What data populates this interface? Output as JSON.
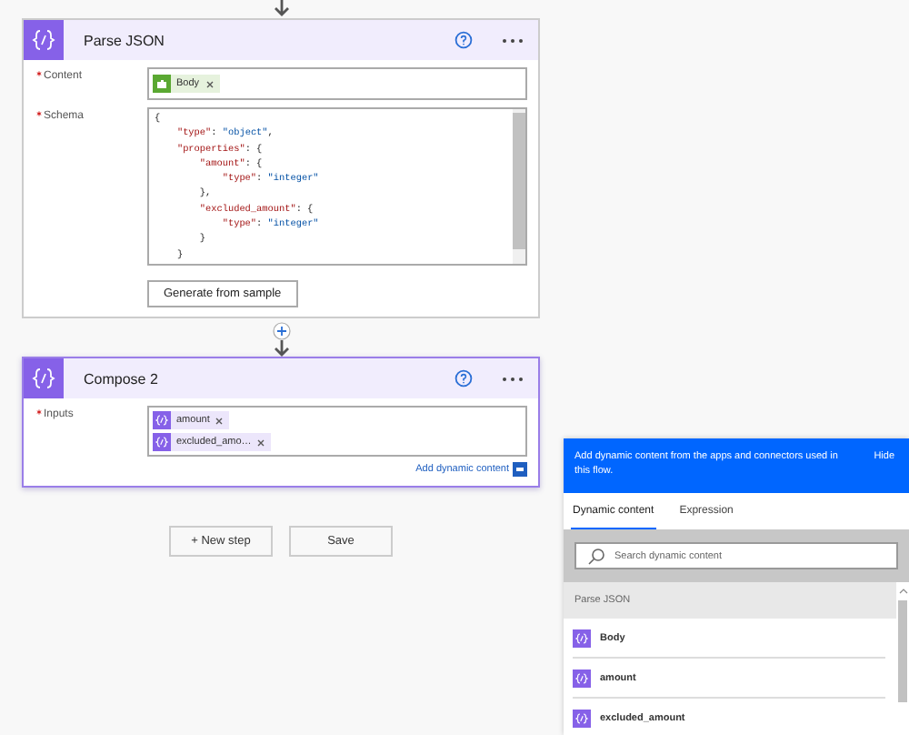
{
  "cards": [
    {
      "title": "Parse JSON",
      "selected": false,
      "fields": [
        {
          "label": "Content",
          "required": true,
          "kind": "tokens",
          "tokens": [
            {
              "label": "Body",
              "kind": "trigger"
            }
          ]
        },
        {
          "label": "Schema",
          "required": true,
          "kind": "code",
          "lines": [
            "{",
            "    \"type\": \"object\",",
            "    \"properties\": {",
            "        \"amount\": {",
            "            \"type\": \"integer\"",
            "        },",
            "        \"excluded_amount\": {",
            "            \"type\": \"integer\"",
            "        }",
            "    }"
          ]
        }
      ],
      "button": "Generate from sample"
    },
    {
      "title": "Compose 2",
      "selected": true,
      "fields": [
        {
          "label": "Inputs",
          "required": true,
          "kind": "tokens",
          "tokens": [
            {
              "label": "amount",
              "kind": "variable"
            },
            {
              "label": "excluded_amo…",
              "kind": "variable"
            }
          ]
        }
      ],
      "link": "Add dynamic content"
    }
  ],
  "actions": [
    "+ New step",
    "Save"
  ],
  "dynamic_panel": {
    "message": "Add dynamic content from the apps and connectors used in this flow.",
    "hide": "Hide",
    "tabs": [
      {
        "label": "Dynamic content",
        "selected": true
      },
      {
        "label": "Expression",
        "selected": false
      }
    ],
    "search": {
      "placeholder": "Search dynamic content"
    },
    "group": "Parse JSON",
    "items": [
      "Body",
      "amount",
      "excluded_amount"
    ]
  }
}
